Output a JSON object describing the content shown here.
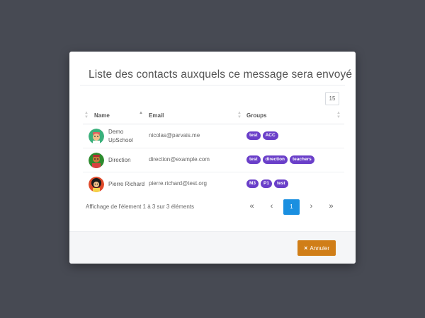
{
  "modal": {
    "title": "Liste des contacts auxquels ce message sera envoyé",
    "page_size": "15"
  },
  "table": {
    "columns": [
      "Name",
      "Email",
      "Groups"
    ],
    "rows": [
      {
        "name": "Demo UpSchool",
        "email": "nicolas@parvais.me",
        "groups": [
          "test",
          "ACC"
        ],
        "avatar_color": "#3ab07b"
      },
      {
        "name": "Direction",
        "email": "direction@example.com",
        "groups": [
          "test",
          "direction",
          "teachers"
        ],
        "avatar_color": "#2e8b2e"
      },
      {
        "name": "Pierre Richard",
        "email": "pierre.richard@test.org",
        "groups": [
          "M3",
          "P1",
          "test"
        ],
        "avatar_color": "#e04a2a"
      }
    ]
  },
  "pagination": {
    "info": "Affichage de l'élement 1 à 3 sur 3 éléments",
    "first": "«",
    "prev": "‹",
    "current": "1",
    "next": "›",
    "last": "»"
  },
  "footer": {
    "cancel_icon": "×",
    "cancel_label": "Annuler"
  },
  "colors": {
    "badge": "#6a3fc9",
    "active_page": "#1a8fe0",
    "cancel_button": "#d07e18",
    "backdrop": "#474a53"
  }
}
